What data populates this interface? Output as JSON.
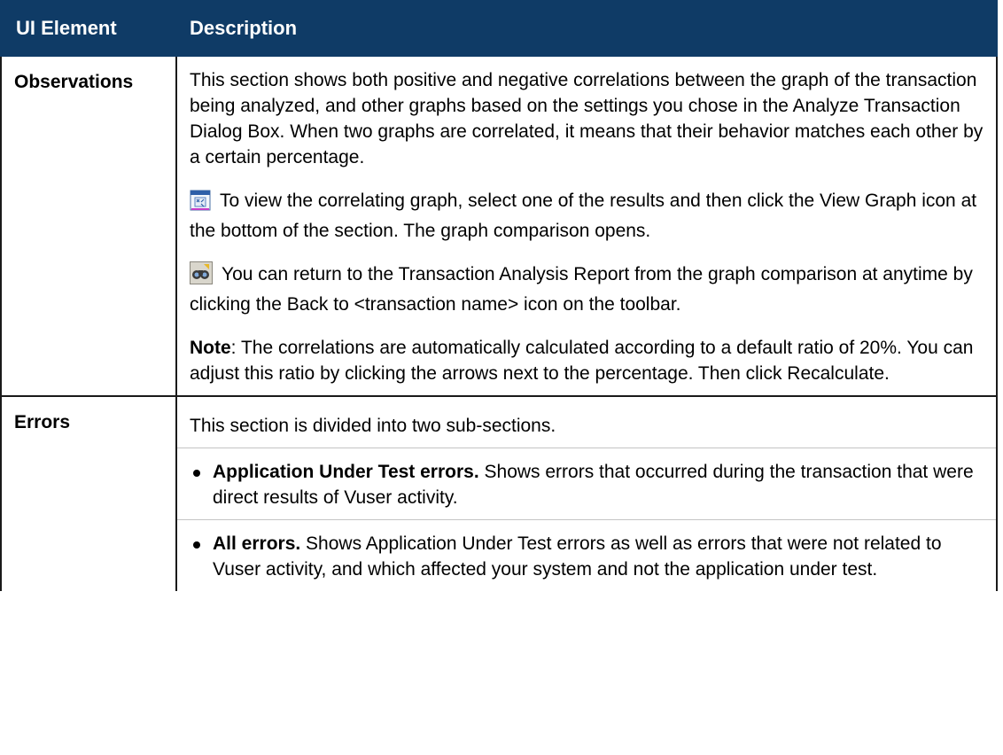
{
  "table": {
    "headers": {
      "element": "UI Element",
      "description": "Description"
    },
    "rows": {
      "observations": {
        "element": "Observations",
        "para1": "This section shows both positive and negative correlations between the graph of the transaction being analyzed, and other graphs based on the settings you chose in the Analyze Transaction Dialog Box. When two graphs are correlated, it means that their behavior matches each other by a certain percentage.",
        "para2": "To view the correlating graph, select one of the results and then click the View Graph icon at the bottom of the section. The graph comparison opens.",
        "para3": "You can return to the Transaction Analysis Report from the graph comparison at anytime by clicking the Back to <transaction name> icon on the toolbar.",
        "note_label": "Note",
        "note_text": ": The correlations are automatically calculated according to a default ratio of 20%. You can adjust this ratio by clicking the arrows next to the percentage. Then click Recalculate."
      },
      "errors": {
        "element": "Errors",
        "intro": "This section is divided into two sub-sections.",
        "bullets": [
          {
            "label": "Application Under Test errors.",
            "text": " Shows errors that occurred during the transaction that were direct results of Vuser activity."
          },
          {
            "label": "All errors.",
            "text": " Shows Application Under Test errors as well as errors that were not related to Vuser activity, and which affected your system and not the application under test."
          }
        ]
      }
    }
  },
  "icons": {
    "view_graph": "view-graph-icon",
    "back_to_transaction": "binoculars-back-icon"
  }
}
